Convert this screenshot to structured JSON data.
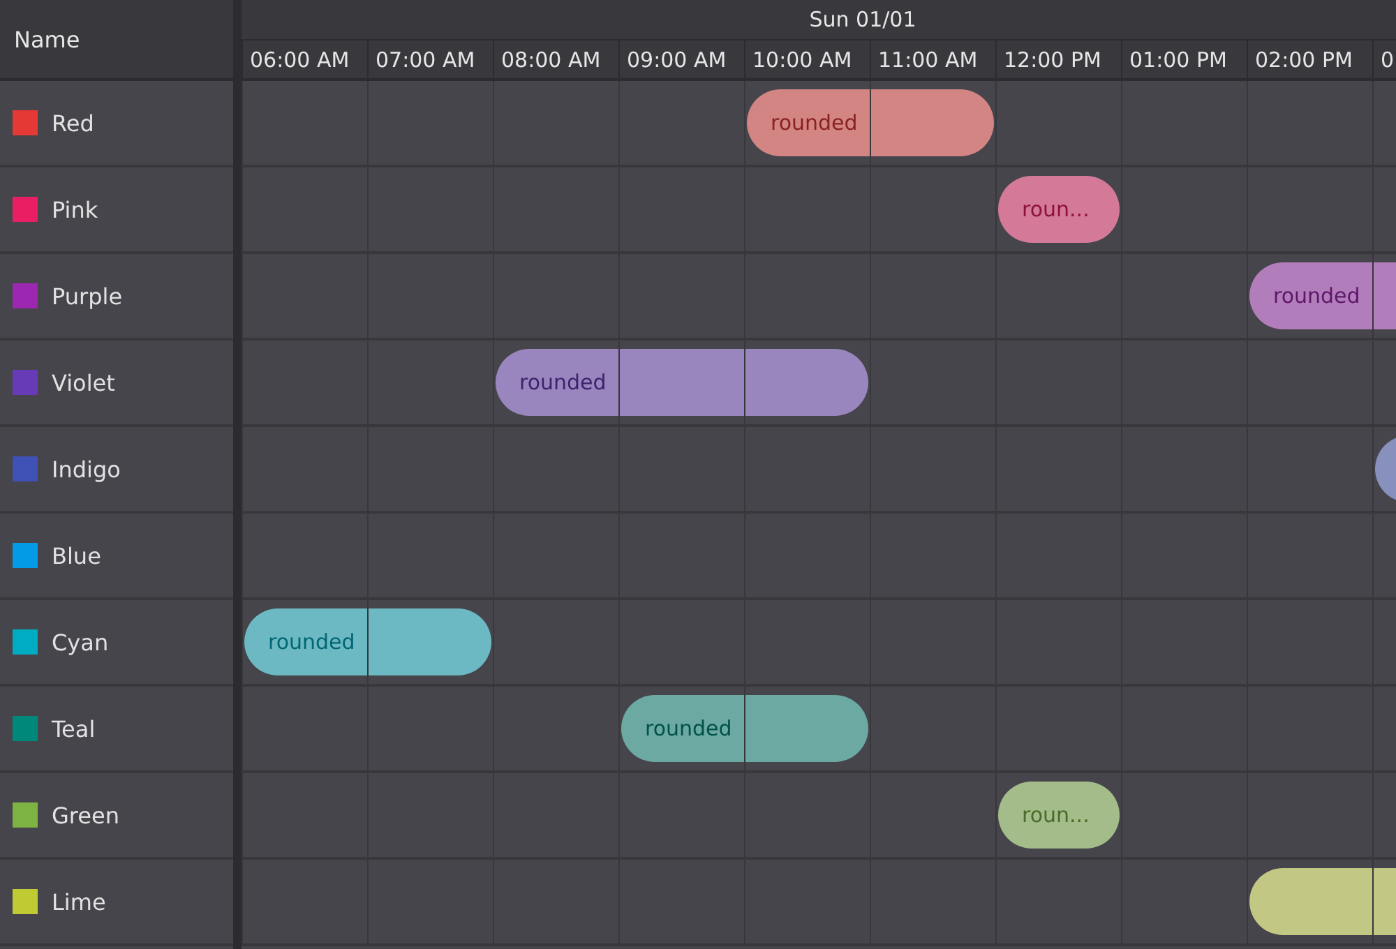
{
  "name_header": "Name",
  "date_header": "Sun 01/01",
  "time_columns": [
    "06:00 AM",
    "07:00 AM",
    "08:00 AM",
    "09:00 AM",
    "10:00 AM",
    "11:00 AM",
    "12:00 PM",
    "01:00 PM",
    "02:00 PM",
    "0"
  ],
  "resources": [
    {
      "name": "Red",
      "color": "#e53935",
      "slots": [
        {
          "booked": false
        },
        {
          "booked": false
        },
        {
          "booked": false
        },
        {
          "booked": false
        },
        {
          "booked": true,
          "label": "rounded"
        },
        {
          "booked": true
        },
        {
          "booked": false
        },
        {
          "booked": false
        },
        {
          "booked": false
        },
        {
          "booked": false
        }
      ]
    },
    {
      "name": "Pink",
      "color": "#e91e63",
      "slots": [
        {
          "booked": false
        },
        {
          "booked": false
        },
        {
          "booked": false
        },
        {
          "booked": false
        },
        {
          "booked": false
        },
        {
          "booked": false
        },
        {
          "booked": true,
          "label": "roun..."
        },
        {
          "booked": false
        },
        {
          "booked": false
        },
        {
          "booked": false
        }
      ]
    },
    {
      "name": "Purple",
      "color": "#9c27b0",
      "slots": [
        {
          "booked": false
        },
        {
          "booked": false
        },
        {
          "booked": false
        },
        {
          "booked": false
        },
        {
          "booked": false
        },
        {
          "booked": false
        },
        {
          "booked": false
        },
        {
          "booked": false
        },
        {
          "booked": true,
          "label": "rounded"
        },
        {
          "booked": true
        }
      ]
    },
    {
      "name": "Violet",
      "color": "#673ab7",
      "slots": [
        {
          "booked": false
        },
        {
          "booked": false
        },
        {
          "booked": true,
          "label": "rounded"
        },
        {
          "booked": true
        },
        {
          "booked": true
        },
        {
          "booked": false
        },
        {
          "booked": false
        },
        {
          "booked": false
        },
        {
          "booked": false
        },
        {
          "booked": false
        }
      ]
    },
    {
      "name": "Indigo",
      "color": "#3f51b5",
      "slots": [
        {
          "booked": false
        },
        {
          "booked": false
        },
        {
          "booked": false
        },
        {
          "booked": false
        },
        {
          "booked": false
        },
        {
          "booked": false
        },
        {
          "booked": false
        },
        {
          "booked": false
        },
        {
          "booked": false
        },
        {
          "booked": true
        }
      ]
    },
    {
      "name": "Blue",
      "color": "#039be5",
      "slots": [
        {
          "booked": false
        },
        {
          "booked": false
        },
        {
          "booked": false
        },
        {
          "booked": false
        },
        {
          "booked": false
        },
        {
          "booked": false
        },
        {
          "booked": false
        },
        {
          "booked": false
        },
        {
          "booked": false
        },
        {
          "booked": false
        }
      ]
    },
    {
      "name": "Cyan",
      "color": "#00acc1",
      "slots": [
        {
          "booked": true,
          "label": "rounded"
        },
        {
          "booked": true
        },
        {
          "booked": false
        },
        {
          "booked": false
        },
        {
          "booked": false
        },
        {
          "booked": false
        },
        {
          "booked": false
        },
        {
          "booked": false
        },
        {
          "booked": false
        },
        {
          "booked": false
        }
      ]
    },
    {
      "name": "Teal",
      "color": "#00897b",
      "slots": [
        {
          "booked": false
        },
        {
          "booked": false
        },
        {
          "booked": false
        },
        {
          "booked": true,
          "label": "rounded"
        },
        {
          "booked": true
        },
        {
          "booked": false
        },
        {
          "booked": false
        },
        {
          "booked": false
        },
        {
          "booked": false
        },
        {
          "booked": false
        }
      ]
    },
    {
      "name": "Green",
      "color": "#7cb342",
      "slots": [
        {
          "booked": false
        },
        {
          "booked": false
        },
        {
          "booked": false
        },
        {
          "booked": false
        },
        {
          "booked": false
        },
        {
          "booked": false
        },
        {
          "booked": true,
          "label": "roun..."
        },
        {
          "booked": false
        },
        {
          "booked": false
        },
        {
          "booked": false
        }
      ]
    },
    {
      "name": "Lime",
      "color": "#c0ca33",
      "slots": [
        {
          "booked": false
        },
        {
          "booked": false
        },
        {
          "booked": false
        },
        {
          "booked": false
        },
        {
          "booked": false
        },
        {
          "booked": false
        },
        {
          "booked": false
        },
        {
          "booked": false
        },
        {
          "booked": true
        },
        {
          "booked": true
        }
      ]
    }
  ]
}
